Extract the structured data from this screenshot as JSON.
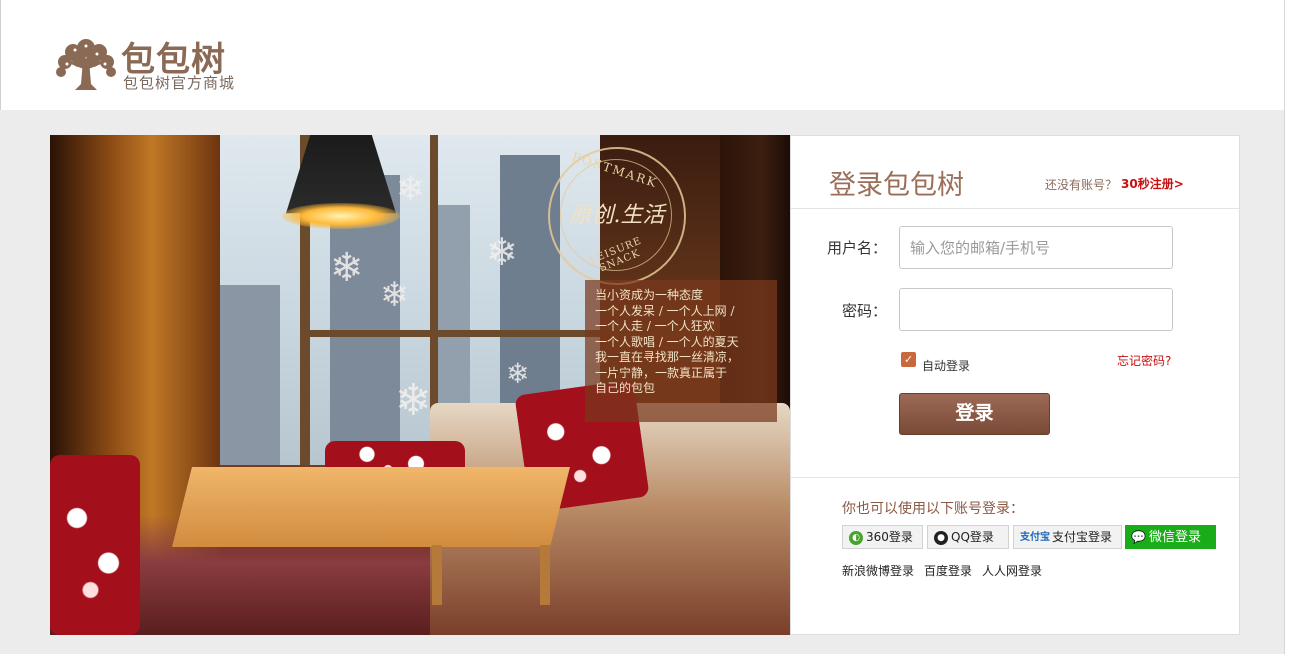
{
  "brand": {
    "title": "包包树",
    "subtitle": "包包树官方商城"
  },
  "hero": {
    "stamp_top": "POSTMARK",
    "stamp_main": "原创.生活",
    "stamp_bottom": "LEISURE SNACK",
    "poem_lines": [
      "当小资成为一种态度",
      "一个人发呆 / 一个人上网 /",
      "一个人走 / 一个人狂欢",
      "一个人歌唱 / 一个人的夏天",
      "我一直在寻找那一丝清凉，",
      "一片宁静，一款真正属于",
      "自己的包包"
    ]
  },
  "login": {
    "title": "登录包包树",
    "register_hint": "还没有账号？",
    "register_link": "30秒注册>",
    "username_label": "用户名：",
    "username_placeholder": "输入您的邮箱/手机号",
    "password_label": "密码：",
    "auto_login_label": "自动登录",
    "auto_login_checked": true,
    "forgot_link": "忘记密码?",
    "submit_label": "登录",
    "alt_title": "你也可以使用以下账号登录：",
    "social_buttons": [
      {
        "label": "360登录",
        "icon": "360-icon"
      },
      {
        "label": "QQ登录",
        "icon": "qq-penguin-icon"
      },
      {
        "label": "支付宝登录",
        "icon": "alipay-icon",
        "icon_text": "支付宝"
      },
      {
        "label": "微信登录",
        "icon": "wechat-icon"
      }
    ],
    "text_links": [
      "新浪微博登录",
      "百度登录",
      "人人网登录"
    ]
  },
  "colors": {
    "brand_brown": "#8b6a55",
    "accent_red": "#c81010",
    "button_brown": "#7a4a38",
    "wechat_green": "#1aad19"
  }
}
